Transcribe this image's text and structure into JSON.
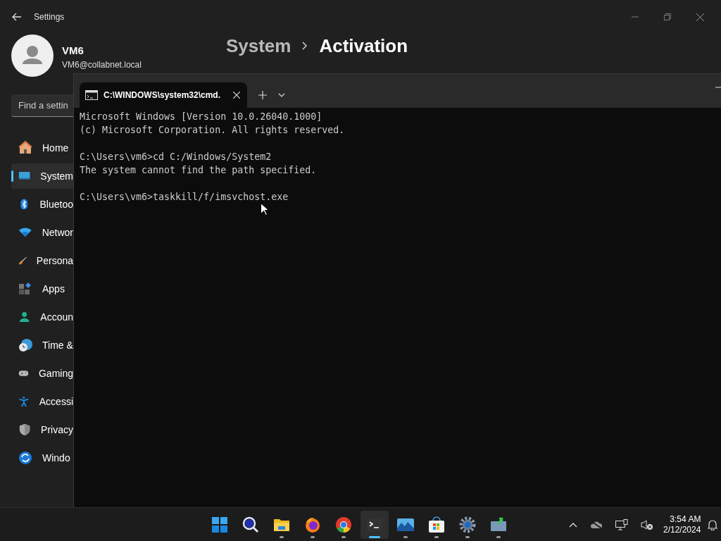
{
  "settings": {
    "title": "Settings",
    "user": {
      "name": "VM6",
      "email": "VM6@collabnet.local"
    },
    "search": {
      "placeholder": "Find a settin"
    },
    "breadcrumb": [
      "System",
      "Activation"
    ],
    "nav": [
      {
        "label": "Home",
        "selected": false
      },
      {
        "label": "System",
        "selected": true
      },
      {
        "label": "Bluetoo",
        "selected": false
      },
      {
        "label": "Networ",
        "selected": false
      },
      {
        "label": "Persona",
        "selected": false
      },
      {
        "label": "Apps",
        "selected": false
      },
      {
        "label": "Accoun",
        "selected": false
      },
      {
        "label": "Time &",
        "selected": false
      },
      {
        "label": "Gaming",
        "selected": false
      },
      {
        "label": "Accessi",
        "selected": false
      },
      {
        "label": "Privacy",
        "selected": false
      },
      {
        "label": "Windo",
        "selected": false
      }
    ]
  },
  "terminal": {
    "tab": {
      "title": "C:\\WINDOWS\\system32\\cmd."
    },
    "blocks": [
      {
        "lines": [
          "Microsoft Windows [Version 10.0.26040.1000]",
          "(c) Microsoft Corporation. All rights reserved."
        ]
      },
      {
        "lines": [
          "C:\\Users\\vm6>cd C:/Windows/System2",
          "The system cannot find the path specified."
        ]
      },
      {
        "lines": [
          "C:\\Users\\vm6>taskkill/f/imsvchost.exe"
        ]
      }
    ]
  },
  "taskbar": {
    "apps": [
      {
        "running": false,
        "selected": false
      },
      {
        "running": false,
        "selected": false
      },
      {
        "running": true,
        "selected": false
      },
      {
        "running": true,
        "selected": false
      },
      {
        "running": true,
        "selected": false
      },
      {
        "running": true,
        "selected": true
      },
      {
        "running": true,
        "selected": false
      },
      {
        "running": true,
        "selected": false
      },
      {
        "running": true,
        "selected": false
      },
      {
        "running": true,
        "selected": false
      }
    ],
    "time": "3:54 AM",
    "date": "2/12/2024"
  }
}
